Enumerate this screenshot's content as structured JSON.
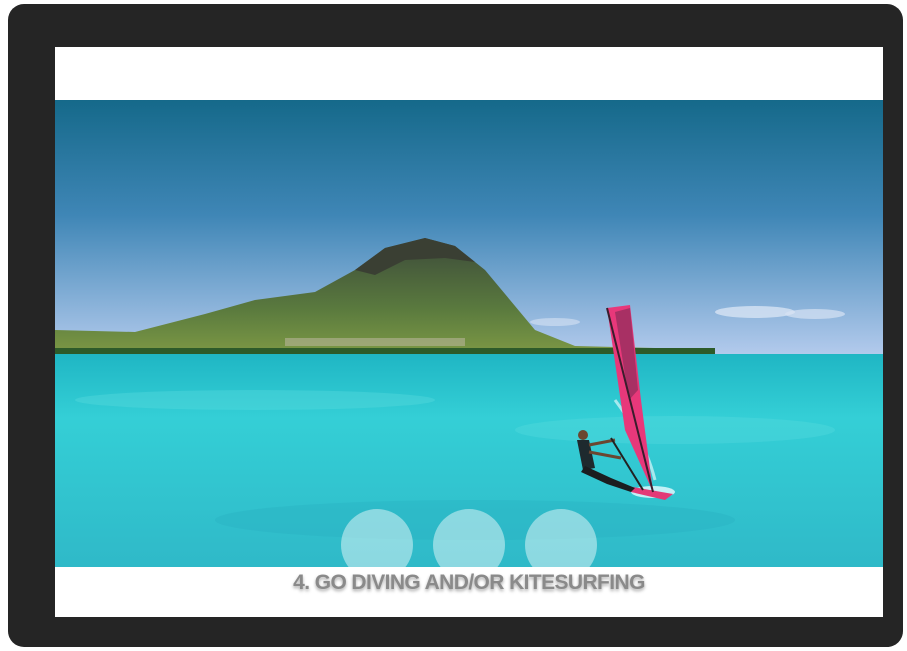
{
  "slide": {
    "caption": "4. GO DIVING AND/OR KITESURFING",
    "image_subject": "windsurfer on turquoise lagoon with mountain island",
    "indicator_count": 3
  },
  "colors": {
    "frame": "#252525",
    "screen_background": "#ffffff",
    "sky_top": "#1b6f8f",
    "sky_bottom": "#a7c3e8",
    "water": "#2ec9d2",
    "sail": "#e8387a",
    "caption_text": "#8a8a8a",
    "indicator": "rgba(255,255,255,0.45)"
  },
  "icons": {
    "indicators": [
      "dot-icon",
      "dot-icon",
      "dot-icon"
    ]
  }
}
